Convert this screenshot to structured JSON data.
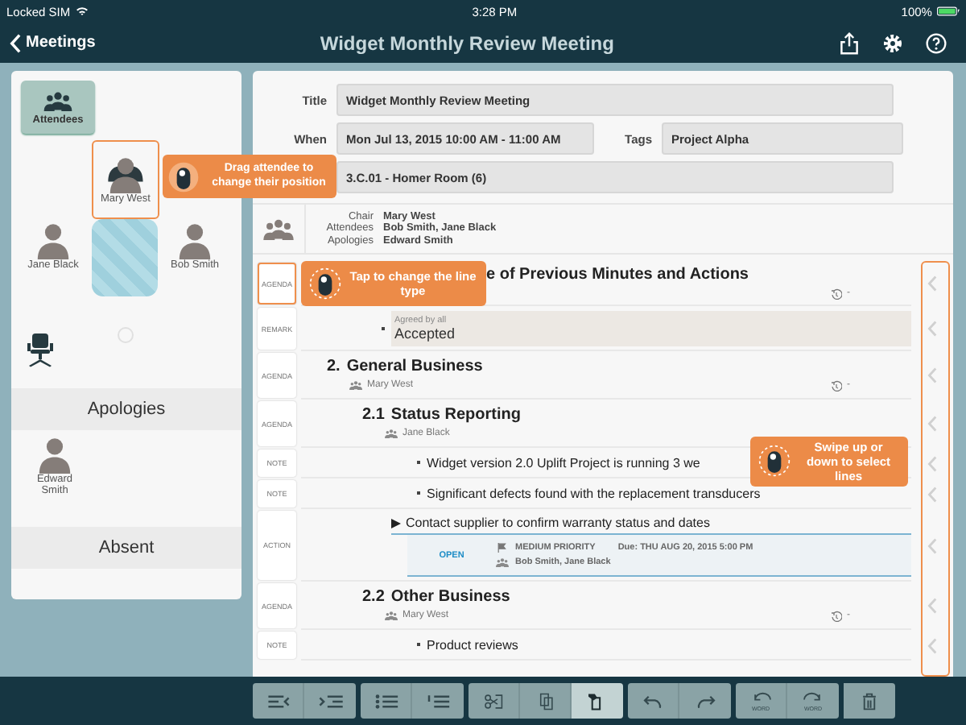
{
  "status_bar": {
    "carrier": "Locked SIM",
    "time": "3:28 PM",
    "battery": "100%"
  },
  "nav": {
    "back": "Meetings",
    "title": "Widget Monthly Review Meeting"
  },
  "left_panel": {
    "attendees_button": {
      "label": "Attendees",
      "selected": true
    },
    "head_seat": {
      "name": "Mary West",
      "kind": "chair",
      "selected": true
    },
    "side_seats": [
      {
        "name": "Jane Black",
        "kind": "member",
        "selected": false
      },
      {
        "name": "Bob Smith",
        "kind": "member",
        "selected": false
      }
    ],
    "drag_tip": "Drag attendee to change their position",
    "apologies": {
      "title": "Apologies",
      "people": [
        "Edward Smith"
      ]
    },
    "absent": {
      "title": "Absent"
    }
  },
  "form": {
    "title_label": "Title",
    "title": "Widget Monthly Review Meeting",
    "when_label": "When",
    "when": "Mon Jul 13, 2015 10:00 AM - 11:00 AM",
    "tags_label": "Tags",
    "tags": "Project Alpha",
    "location": "3.C.01 - Homer Room (6)"
  },
  "summary": [
    {
      "label": "Chair",
      "value": "Mary West"
    },
    {
      "label": "Attendees",
      "value": "Bob Smith, Jane Black"
    },
    {
      "label": "Apologies",
      "value": "Edward Smith"
    }
  ],
  "lines": [
    {
      "kind": "agenda",
      "tag": "AGENDA",
      "selected": true,
      "tip": "Tap to change the line type",
      "title": "e of Previous Minutes and Actions",
      "duration": "-",
      "children": [
        {
          "kind": "remark",
          "tag": "REMARK",
          "selected": false,
          "label": "Agreed by all",
          "text": "Accepted"
        }
      ]
    },
    {
      "kind": "agenda",
      "tag": "AGENDA",
      "selected": false,
      "number": "2.",
      "title": "General Business",
      "presenter": "Mary West",
      "duration": "-",
      "children": [
        {
          "kind": "agenda",
          "tag": "AGENDA",
          "selected": false,
          "number": "2.1",
          "title": "Status Reporting",
          "presenter": "Jane Black",
          "children": [
            {
              "kind": "note",
              "tag": "NOTE",
              "selected": false,
              "text": "Widget version 2.0 Uplift Project is running 3 we",
              "tip": "Swipe up or down to select lines"
            },
            {
              "kind": "note",
              "tag": "NOTE",
              "selected": false,
              "text": "Significant defects found with the replacement transducers"
            },
            {
              "kind": "action",
              "tag": "ACTION",
              "selected": false,
              "text": "Contact supplier to confirm warranty status and dates",
              "status": "OPEN",
              "priority": "MEDIUM PRIORITY",
              "due": "Due: THU AUG 20, 2015 5:00 PM",
              "assignees": "Bob Smith, Jane Black"
            }
          ]
        },
        {
          "kind": "agenda",
          "tag": "AGENDA",
          "selected": false,
          "number": "2.2",
          "title": "Other Business",
          "presenter": "Mary West",
          "duration": "-",
          "children": [
            {
              "kind": "note",
              "tag": "NOTE",
              "selected": false,
              "text": "Product reviews"
            }
          ]
        }
      ]
    }
  ],
  "toolbar": [
    [
      {
        "kind": "outdent",
        "selected": false
      },
      {
        "kind": "indent",
        "selected": false
      }
    ],
    [
      {
        "kind": "bullets",
        "selected": false
      },
      {
        "kind": "numbers",
        "selected": false
      }
    ],
    [
      {
        "kind": "cut",
        "selected": false
      },
      {
        "kind": "copy",
        "selected": false
      },
      {
        "kind": "paste",
        "selected": true
      }
    ],
    [
      {
        "kind": "undo",
        "selected": false
      },
      {
        "kind": "redo",
        "selected": false
      }
    ],
    [
      {
        "kind": "undo-word",
        "label": "WORD",
        "selected": false
      },
      {
        "kind": "redo-word",
        "label": "WORD",
        "selected": false
      }
    ],
    [
      {
        "kind": "delete",
        "selected": false
      }
    ]
  ]
}
